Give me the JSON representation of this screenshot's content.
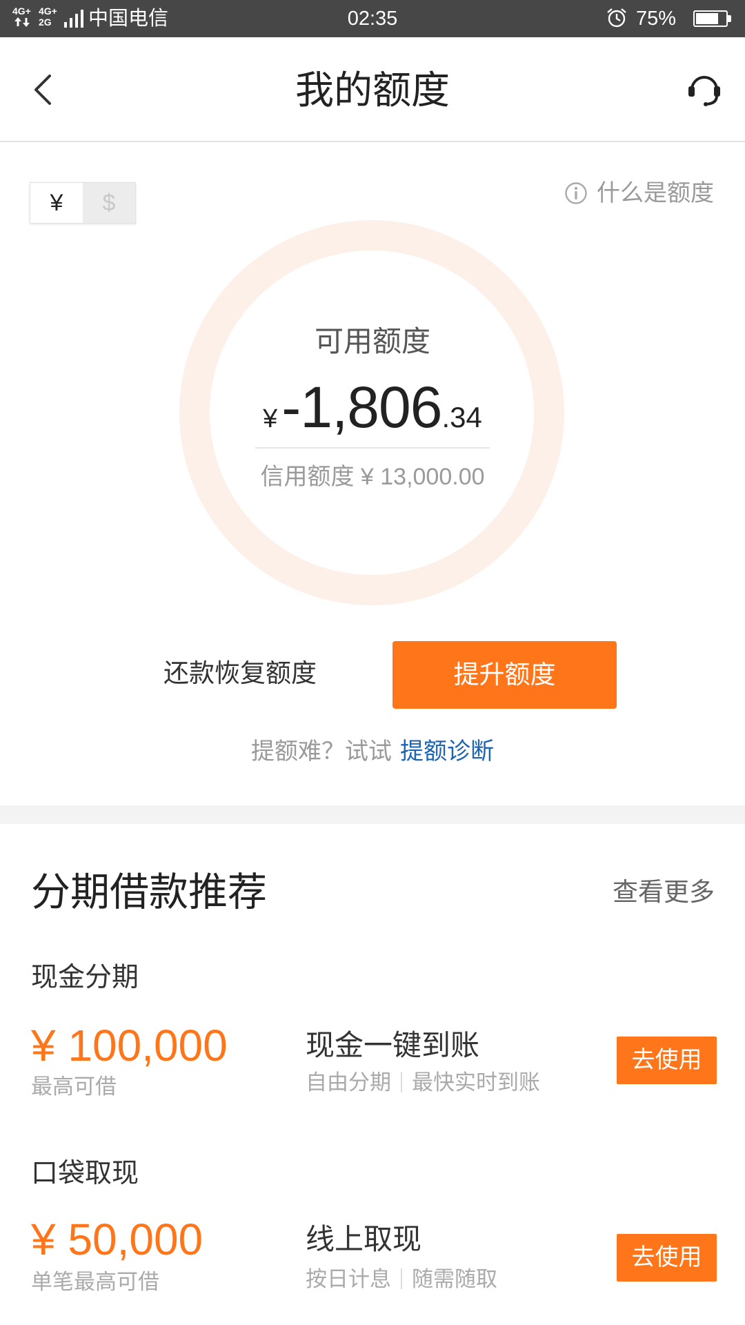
{
  "status_bar": {
    "signal_1_top": "4G+",
    "signal_2_top": "4G+",
    "signal_2_bottom": "2G",
    "carrier": "中国电信",
    "time": "02:35",
    "battery_text": "75%",
    "battery_level": 0.75,
    "icons": [
      "data-arrows-icon",
      "signal-bars-icon",
      "alarm-icon",
      "battery-icon"
    ]
  },
  "header": {
    "title": "我的额度",
    "back_icon": "chevron-left-icon",
    "service_icon": "headset-icon"
  },
  "currency_toggle": {
    "options": [
      "¥",
      "$"
    ],
    "selected": "¥"
  },
  "help_link": {
    "icon": "info-icon",
    "label": "什么是额度"
  },
  "quota": {
    "available_label": "可用额度",
    "currency_symbol": "¥",
    "available_integer": "-1,806",
    "available_decimal": ".34",
    "credit_label": "信用额度",
    "credit_value": "¥ 13,000.00"
  },
  "actions": {
    "repay_label": "还款恢复额度",
    "raise_label": "提升额度"
  },
  "hint": {
    "text": "提额难？试试",
    "link": "提额诊断"
  },
  "recommend": {
    "title": "分期借款推荐",
    "more": "查看更多",
    "items": [
      {
        "name": "现金分期",
        "amount": "¥ 100,000",
        "amount_label": "最高可借",
        "feature": "现金一键到账",
        "tags": [
          "自由分期",
          "最快实时到账"
        ],
        "button": "去使用"
      },
      {
        "name": "口袋取现",
        "amount": "¥ 50,000",
        "amount_label": "单笔最高可借",
        "feature": "线上取现",
        "tags": [
          "按日计息",
          "随需随取"
        ],
        "button": "去使用"
      }
    ]
  },
  "colors": {
    "accent": "#ff7519",
    "link": "#1d65b3",
    "ring": "#fdf0e8",
    "status_bar_bg": "#474747",
    "section_gap": "#f3f3f3"
  }
}
